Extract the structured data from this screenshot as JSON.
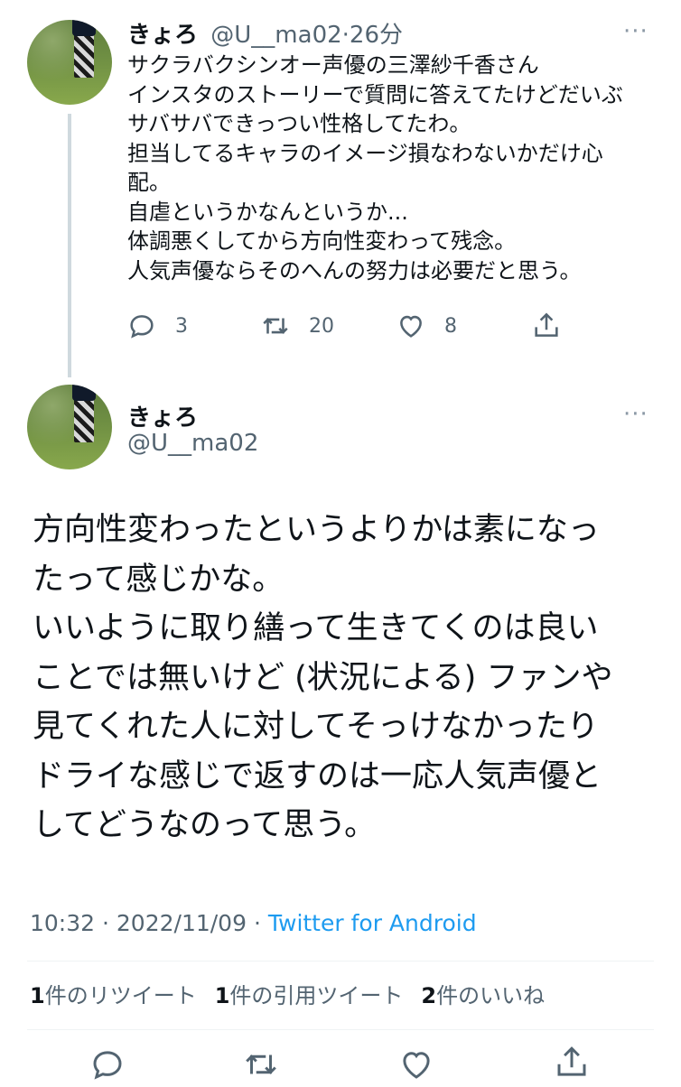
{
  "reply_tweet": {
    "display_name": "きょろ",
    "handle": "@U__ma02",
    "separator": "·",
    "time_ago": "26分",
    "more": "···",
    "lines": [
      "サクラバクシンオー声優の三澤紗千香さん",
      "インスタのストーリーで質問に答えてたけどだいぶ",
      "サバサバできっつい性格してたわ。",
      "担当してるキャラのイメージ損なわないかだけ心",
      "配。",
      "自虐というかなんというか...",
      "体調悪くしてから方向性変わって残念。",
      "人気声優ならそのへんの努力は必要だと思う。"
    ],
    "reply_count": "3",
    "retweet_count": "20",
    "like_count": "8"
  },
  "main_tweet": {
    "display_name": "きょろ",
    "handle": "@U__ma02",
    "more": "···",
    "lines": [
      "方向性変わったというよりかは素になっ",
      "たって感じかな。",
      "いいように取り繕って生きてくのは良い",
      "ことでは無いけど (状況による) ファンや",
      "見てくれた人に対してそっけなかったり",
      "ドライな感じで返すのは一応人気声優と",
      "してどうなのって思う。"
    ],
    "time": "10:32",
    "date": "2022/11/09",
    "meta_sep": "·",
    "source": "Twitter for Android",
    "stats": {
      "retweets_num": "1",
      "retweets_label": "件のリツイート",
      "quotes_num": "1",
      "quotes_label": "件の引用ツイート",
      "likes_num": "2",
      "likes_label": "件のいいね"
    }
  },
  "icons": [
    "reply-icon",
    "retweet-icon",
    "like-icon",
    "share-icon",
    "more-icon"
  ],
  "colors": {
    "text": "#0f1419",
    "secondary": "#536471",
    "link": "#1d9bf0",
    "thread_line": "#cfd9de"
  }
}
